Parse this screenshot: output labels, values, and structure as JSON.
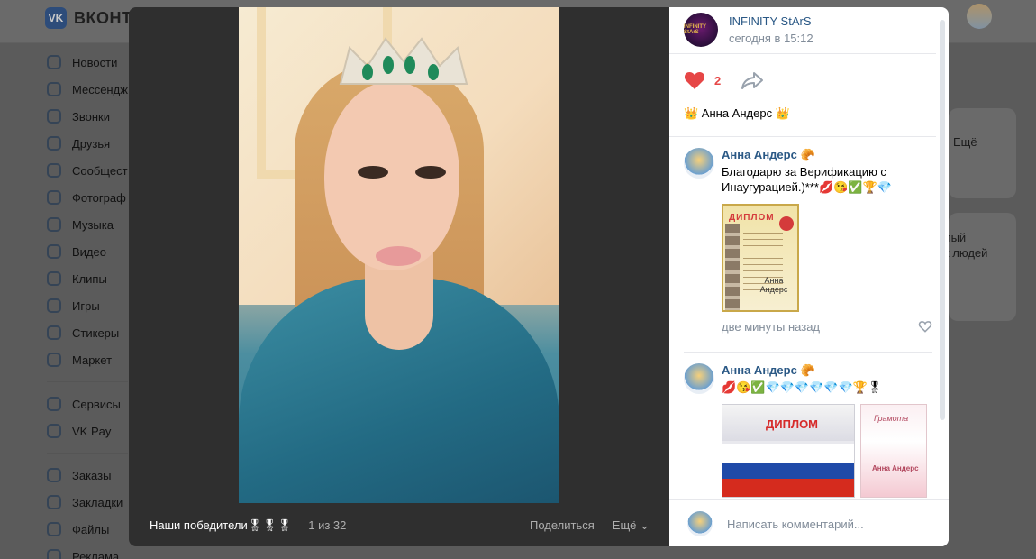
{
  "vk": {
    "brand": "ВКОНТА",
    "logo_text": "VK",
    "sidebar": [
      {
        "icon": "news-icon",
        "label": "Новости"
      },
      {
        "icon": "messenger-icon",
        "label": "Мессендж"
      },
      {
        "icon": "phone-icon",
        "label": "Звонки"
      },
      {
        "icon": "friends-icon",
        "label": "Друзья"
      },
      {
        "icon": "communities-icon",
        "label": "Сообщест"
      },
      {
        "icon": "photos-icon",
        "label": "Фотограф"
      },
      {
        "icon": "music-icon",
        "label": "Музыка"
      },
      {
        "icon": "video-icon",
        "label": "Видео"
      },
      {
        "icon": "clips-icon",
        "label": "Клипы"
      },
      {
        "icon": "games-icon",
        "label": "Игры"
      },
      {
        "icon": "stickers-icon",
        "label": "Стикеры"
      },
      {
        "icon": "market-icon",
        "label": "Маркет"
      }
    ],
    "sidebar_2": [
      {
        "icon": "services-icon",
        "label": "Сервисы"
      },
      {
        "icon": "vkpay-icon",
        "label": "VK Pay"
      }
    ],
    "sidebar_3": [
      {
        "icon": "orders-icon",
        "label": "Заказы"
      },
      {
        "icon": "bookmarks-icon",
        "label": "Закладки"
      },
      {
        "icon": "files-icon",
        "label": "Файлы"
      },
      {
        "icon": "ads-icon",
        "label": "Реклама"
      }
    ],
    "right_more": "Ещё",
    "right_text_1": "лый",
    "right_text_2": "к людей"
  },
  "viewer": {
    "album_title": "Наши победители🎖🎖🎖",
    "counter": "1 из 32",
    "share_label": "Поделиться",
    "more_label": "Ещё ⌄"
  },
  "post": {
    "group_avatar_text": "INFINITY StArS",
    "group_name": "INFINITY StArS",
    "time": "сегодня в 15:12",
    "likes_count": "2",
    "text": "👑 Анна Андерс 👑"
  },
  "comments": [
    {
      "author": "Анна Андерс 🥐",
      "text": "Благодарю за Верификацию с Инаугурацией.)***💋😘✅🏆💎",
      "time": "две минуты назад",
      "attachment": {
        "title": "ДИПЛОМ",
        "name": "Анна Андерс"
      }
    },
    {
      "author": "Анна Андерс 🥐",
      "text": "💋😘✅💎💎💎💎💎💎🏆🎖",
      "attachment_1": {
        "title": "ДИПЛОМ"
      },
      "attachment_2": {
        "title": "Грамота",
        "name": "Анна Андерс"
      }
    }
  ],
  "composer": {
    "placeholder": "Написать комментарий..."
  },
  "colors": {
    "accent_link": "#2a5885",
    "like_red": "#e64646",
    "meta_grey": "#818c99"
  }
}
